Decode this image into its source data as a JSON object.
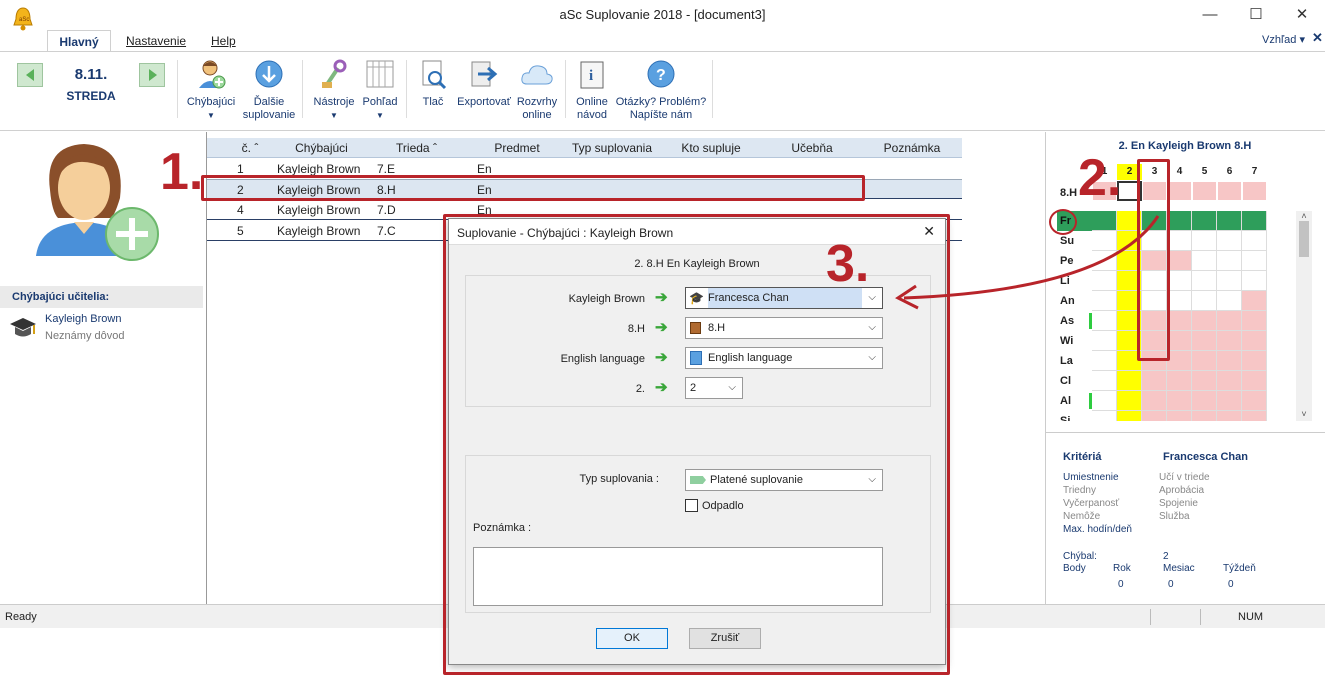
{
  "window": {
    "title": "aSc Suplovanie 2018  - [document3]",
    "min": "—",
    "max": "☐",
    "close": "✕"
  },
  "tabs": [
    "Hlavný",
    "Nastavenie",
    "Help"
  ],
  "view_menu": "Vzhľad ▾",
  "date": {
    "day": "8.11.",
    "weekday": "STREDA"
  },
  "ribbon": {
    "absent": "Chýbajúci",
    "more_subs": [
      "Ďalšie",
      "suplovanie"
    ],
    "tools": "Nástroje",
    "view": "Pohľad",
    "print": "Tlač",
    "export": "Exportovať",
    "schedule_online": [
      "Rozvrhy",
      "online"
    ],
    "online_guide": [
      "Online",
      "návod"
    ],
    "questions": [
      "Otázky? Problém?",
      "Napíšte nám"
    ]
  },
  "left": {
    "header": "Chýbajúci učitelia:",
    "teacher": "Kayleigh Brown",
    "reason": "Neznámy dôvod"
  },
  "table": {
    "headers": [
      "č.",
      "Chýbajúci",
      "Trieda",
      "Predmet",
      "Typ suplovania",
      "Kto supluje",
      "Učebňa",
      "Poznámka"
    ],
    "rows": [
      [
        "1",
        "Kayleigh Brown",
        "7.E",
        "En"
      ],
      [
        "2",
        "Kayleigh Brown",
        "8.H",
        "En"
      ],
      [
        "4",
        "Kayleigh Brown",
        "7.D",
        "En"
      ],
      [
        "5",
        "Kayleigh Brown",
        "7.C",
        "En"
      ]
    ]
  },
  "right": {
    "title": "2. En Kayleigh Brown 8.H",
    "periods": [
      "1",
      "2",
      "3",
      "4",
      "5",
      "6",
      "7"
    ],
    "class_label": "8.H",
    "teachers": [
      "Fr",
      "Su",
      "Pe",
      "Li",
      "An",
      "As",
      "Wi",
      "La",
      "Cl",
      "Al",
      "Si"
    ],
    "criteria_title": "Kritériá",
    "selected_teacher": "Francesca Chan",
    "criteria_left": [
      "Umiestnenie",
      "Triedny",
      "Vyčerpanosť",
      "Nemôže",
      "Max. hodín/deň"
    ],
    "criteria_right": [
      "Učí v triede",
      "Aprobácia",
      "Spojenie",
      "Služba"
    ],
    "stats_labels": [
      "Chýbal:",
      "Body",
      "Rok",
      "Mesiac",
      "Týždeň"
    ],
    "stats_values": [
      "2",
      "0",
      "0",
      "0"
    ]
  },
  "status": {
    "left": "Ready",
    "num": "NUM"
  },
  "dialog": {
    "title": "Suplovanie - Chýbajúci : Kayleigh Brown",
    "subtitle": "2. 8.H  En Kayleigh Brown",
    "rows": [
      {
        "label": "Kayleigh Brown",
        "value": "Francesca Chan"
      },
      {
        "label": "8.H",
        "value": "8.H"
      },
      {
        "label": "English language",
        "value": "English language"
      },
      {
        "label": "2.",
        "value": "2"
      }
    ],
    "type_label": "Typ suplovania :",
    "type_value": "Platené suplovanie",
    "cancelled": "Odpadlo",
    "note_label": "Poznámka :",
    "ok": "OK",
    "cancel": "Zrušiť"
  },
  "annotations": [
    "1.",
    "2.",
    "3."
  ],
  "colors": {
    "accent": "#1a3a70",
    "green": "#2e9e5b",
    "pink": "#f7c6c6",
    "yellow": "#ffff00",
    "annotation_red": "#b8242a"
  }
}
